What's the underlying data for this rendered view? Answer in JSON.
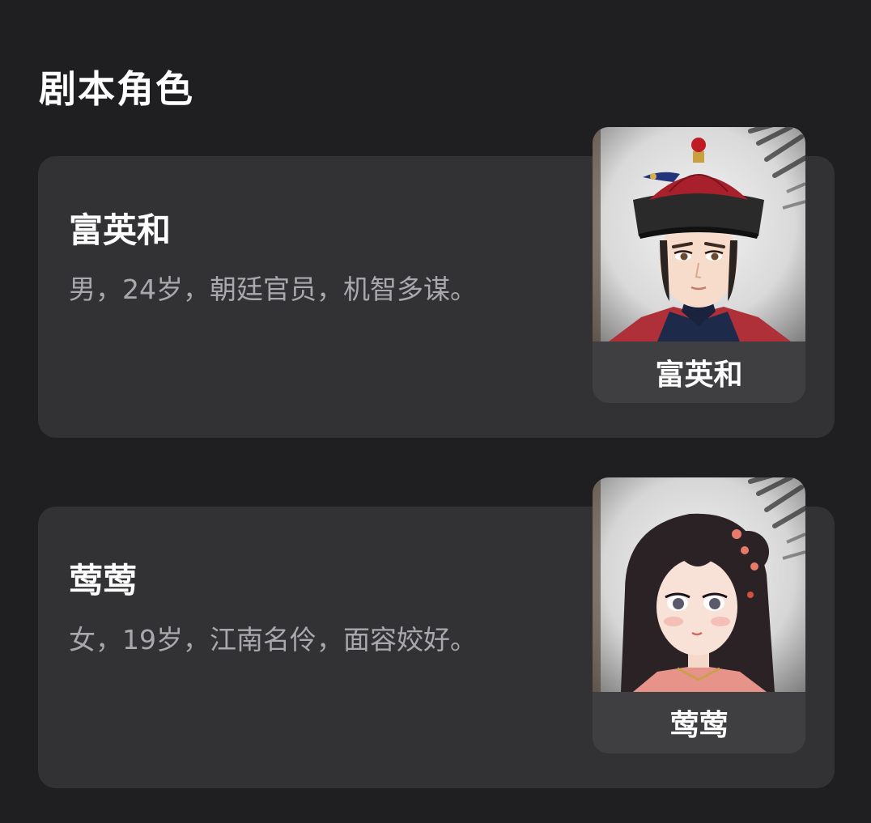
{
  "section": {
    "title": "剧本角色"
  },
  "roles": [
    {
      "name": "富英和",
      "description": "男，24岁，朝廷官员，机智多谋。",
      "portrait_label": "富英和",
      "portrait_icon": "male-official-portrait"
    },
    {
      "name": "莺莺",
      "description": "女，19岁，江南名伶，面容姣好。",
      "portrait_label": "莺莺",
      "portrait_icon": "female-performer-portrait"
    }
  ],
  "colors": {
    "background": "#1f1f21",
    "card": "#323234",
    "label_bar": "#3f3f42",
    "secondary_text": "#a9a9ad"
  }
}
